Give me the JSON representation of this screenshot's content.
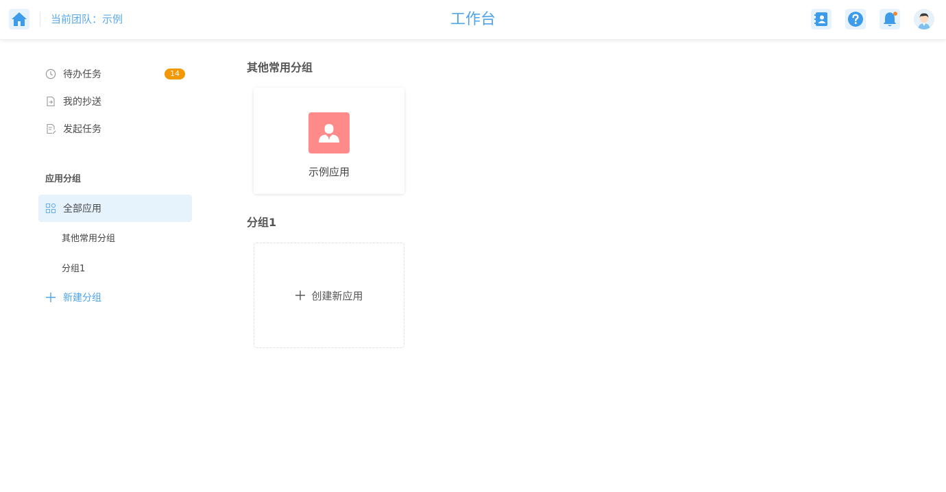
{
  "header": {
    "team_label": "当前团队：示例",
    "title": "工作台"
  },
  "sidebar": {
    "tasks": [
      {
        "label": "待办任务",
        "icon": "clock-icon",
        "badge": "14"
      },
      {
        "label": "我的抄送",
        "icon": "document-forward-icon"
      },
      {
        "label": "发起任务",
        "icon": "document-edit-icon"
      }
    ],
    "section_title": "应用分组",
    "all_apps_label": "全部应用",
    "groups": [
      "其他常用分组",
      "分组1"
    ],
    "new_group_label": "新建分组"
  },
  "main": {
    "groups": [
      {
        "title": "其他常用分组",
        "apps": [
          {
            "name": "示例应用",
            "icon": "user-icon",
            "color": "#ff8a8a"
          }
        ]
      },
      {
        "title": "分组1",
        "create_label": "创建新应用"
      }
    ]
  },
  "colors": {
    "accent": "#4ea3ea",
    "badge": "#f39800",
    "active_bg": "#e6f3fd"
  }
}
